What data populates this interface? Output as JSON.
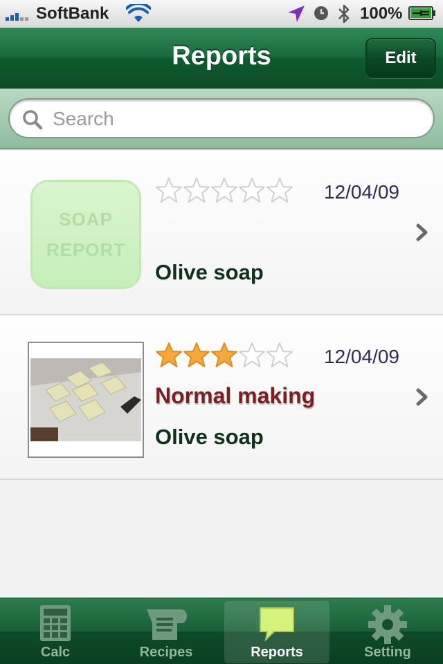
{
  "status_bar": {
    "carrier": "SoftBank",
    "battery_text": "100%",
    "icons": [
      "signal-bars-icon",
      "wifi-icon",
      "location-arrow-icon",
      "alarm-clock-icon",
      "bluetooth-icon",
      "battery-charging-icon"
    ]
  },
  "nav": {
    "title": "Reports",
    "edit_label": "Edit"
  },
  "search": {
    "placeholder": "Search",
    "value": ""
  },
  "reports": [
    {
      "thumbnail": "soap-report-placeholder",
      "thumb_text_line1": "SOAP",
      "thumb_text_line2": "REPORT",
      "rating": 0,
      "rating_max": 5,
      "date": "12/04/09",
      "subtitle": "",
      "name": "Olive soap"
    },
    {
      "thumbnail": "soap-photo",
      "rating": 3,
      "rating_max": 5,
      "date": "12/04/09",
      "subtitle": "Normal making",
      "name": "Olive soap"
    }
  ],
  "tabs": [
    {
      "label": "Calc",
      "icon": "calculator-icon",
      "active": false
    },
    {
      "label": "Recipes",
      "icon": "recipe-scroll-icon",
      "active": false
    },
    {
      "label": "Reports",
      "icon": "speech-bubble-icon",
      "active": true
    },
    {
      "label": "Setting",
      "icon": "gear-icon",
      "active": false
    }
  ],
  "colors": {
    "nav_green": "#1a6a3c",
    "subtitle_red": "#7b1f23",
    "star_gold": "#f7a83a",
    "date_navy": "#2c2c5a"
  }
}
